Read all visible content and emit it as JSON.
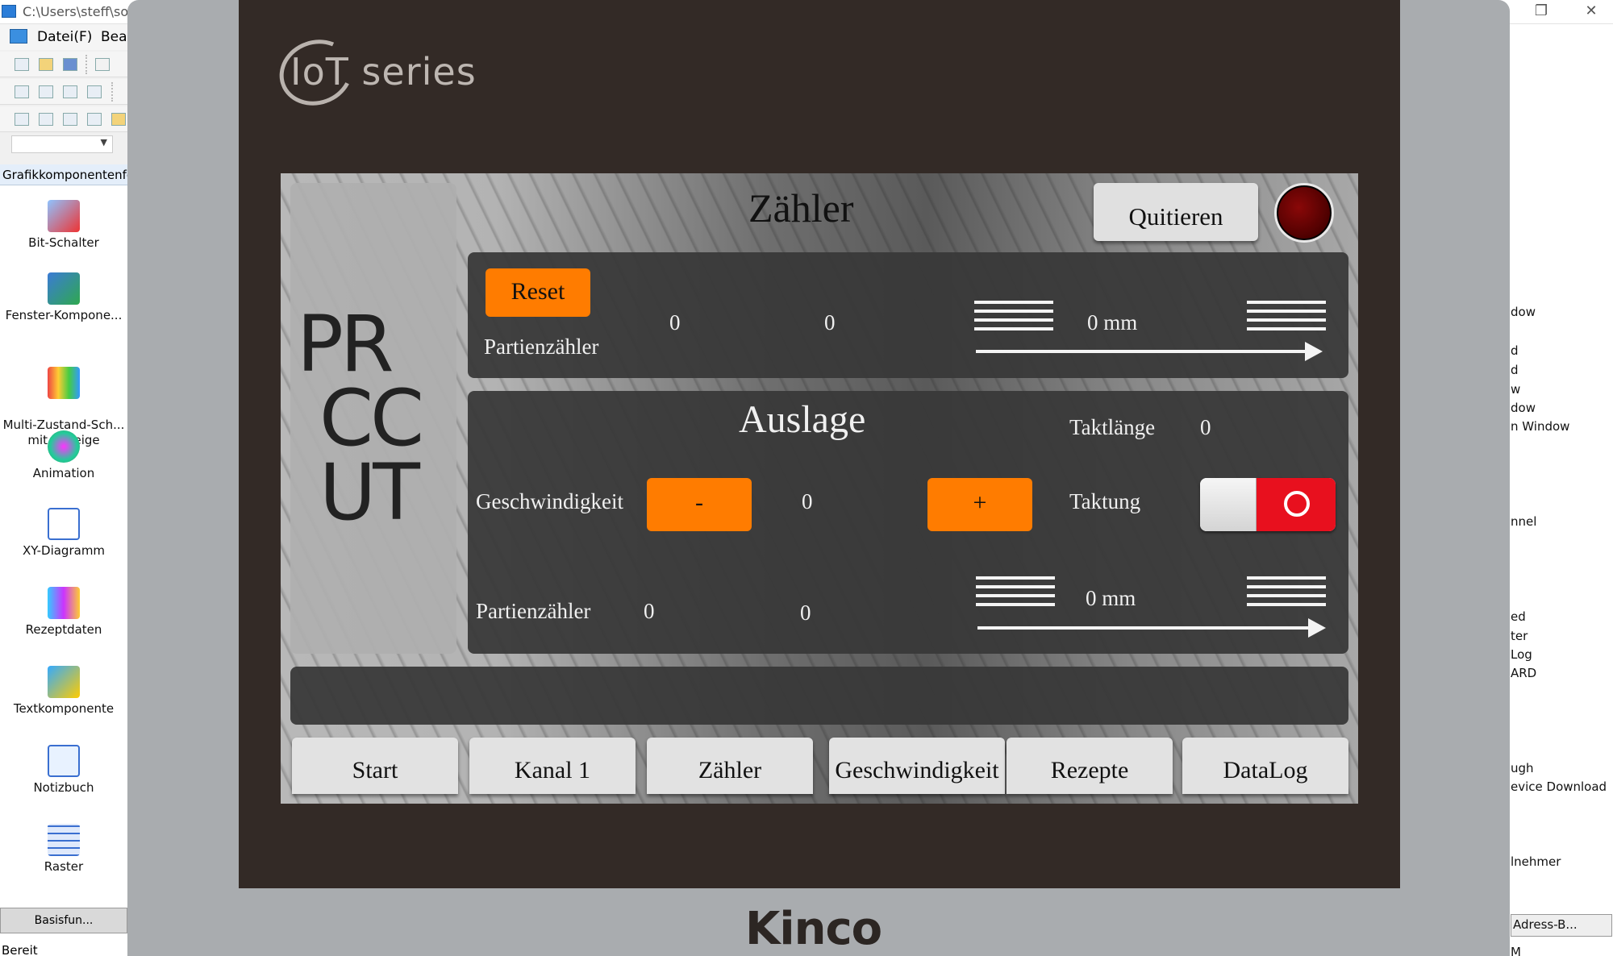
{
  "ide": {
    "window_title": "C:\\Users\\steff\\sour",
    "menu": [
      "Datei(F)",
      "Bear"
    ],
    "panel_title": "Grafikkomponentenfen",
    "components": [
      {
        "label": "Bit-Schalter",
        "icon": "bit-switch-icon"
      },
      {
        "label": "Fenster-Kompone...",
        "icon": "window-component-icon"
      },
      {
        "label": "Multi-Zustand-Sch...\nmit Anzeige",
        "icon": "multi-state-switch-icon"
      },
      {
        "label": "Animation",
        "icon": "animation-icon"
      },
      {
        "label": "XY-Diagramm",
        "icon": "xy-diagram-icon"
      },
      {
        "label": "Rezeptdaten",
        "icon": "recipe-data-icon"
      },
      {
        "label": "Textkomponente",
        "icon": "text-component-icon"
      },
      {
        "label": "Notizbuch",
        "icon": "notebook-icon"
      },
      {
        "label": "Raster",
        "icon": "grid-icon"
      }
    ],
    "bottom_tab": "Basisfun...",
    "status": "Bereit",
    "right_panel_lines": [
      "dow",
      "d",
      "d",
      "w",
      "dow",
      "n Window",
      "nnel",
      "ed",
      "ter",
      "Log",
      "ARD",
      "ugh",
      "evice Download",
      "lnehmer"
    ],
    "right_panel_tab": "Adress-B...",
    "right_panel_bottom": "M"
  },
  "device": {
    "series_logo": "IoT series",
    "brand": "Kinco"
  },
  "hmi": {
    "title": "Zähler",
    "quit_label": "Quitieren",
    "logo_letters": [
      "PR",
      "CC",
      "UT"
    ],
    "kanal": {
      "reset_label": "Reset",
      "counter_label": "Partienzähler",
      "value_a": "0",
      "value_b": "0",
      "length": "0 mm"
    },
    "auslage": {
      "title": "Auslage",
      "taktlaenge_label": "Taktlänge",
      "taktlaenge_value": "0",
      "speed_label": "Geschwindigkeit",
      "minus_label": "-",
      "speed_value": "0",
      "plus_label": "+",
      "taktung_label": "Taktung",
      "counter_label": "Partienzähler",
      "value_a": "0",
      "value_b": "0",
      "length": "0 mm"
    },
    "nav": [
      "Start",
      "Kanal 1",
      "Zähler",
      "Geschwindigkeit",
      "Rezepte",
      "DataLog"
    ],
    "colors": {
      "accent": "#ff7c00",
      "toggle_off": "#e8101e",
      "lamp": "#6a0000",
      "panel": "#383838"
    }
  }
}
